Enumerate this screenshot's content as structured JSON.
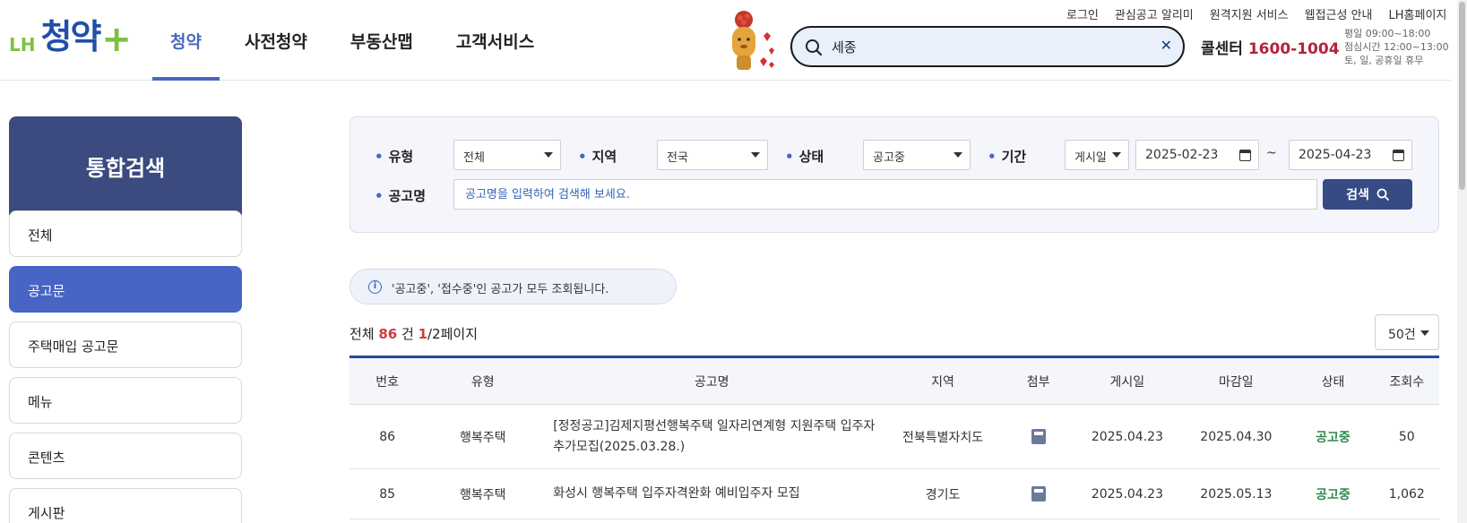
{
  "header": {
    "logo": {
      "brand": "LH",
      "name": "청약",
      "plus": "+"
    },
    "gnb": [
      "청약",
      "사전청약",
      "부동산맵",
      "고객서비스"
    ],
    "search": {
      "value": "세종"
    },
    "util_links": [
      "로그인",
      "관심공고 알리미",
      "원격지원 서비스",
      "웹접근성 안내",
      "LH홈페이지"
    ],
    "callcenter": {
      "label": "콜센터",
      "number": "1600-1004"
    },
    "hours": [
      "평일 09:00~18:00",
      "점심시간 12:00~13:00",
      "토, 일, 공휴일 휴무"
    ]
  },
  "sidebar": {
    "title": "통합검색",
    "items": [
      "전체",
      "공고문",
      "주택매입 공고문",
      "메뉴",
      "콘텐츠",
      "게시판"
    ],
    "active_index": 1
  },
  "filter": {
    "type": {
      "label": "유형",
      "value": "전체"
    },
    "region": {
      "label": "지역",
      "value": "전국"
    },
    "status": {
      "label": "상태",
      "value": "공고중"
    },
    "period": {
      "label": "기간",
      "basis": "게시일",
      "from": "2025-02-23",
      "sep": "~",
      "to": "2025-04-23"
    },
    "title": {
      "label": "공고명",
      "placeholder": "공고명을 입력하여 검색해 보세요."
    },
    "search_button": "검색"
  },
  "notice": "'공고중', '접수중'인 공고가 모두 조회됩니다.",
  "summary": {
    "prefix": "전체 ",
    "total": "86",
    "unit": " 건 ",
    "page": "1",
    "pages": "/2페이지"
  },
  "per_page": "50건",
  "table": {
    "headers": [
      "번호",
      "유형",
      "공고명",
      "지역",
      "첨부",
      "게시일",
      "마감일",
      "상태",
      "조회수"
    ],
    "rows": [
      {
        "no": "86",
        "type": "행복주택",
        "title": "[정정공고]김제지평선행복주택 일자리연계형 지원주택 입주자 추가모집(2025.03.28.)",
        "region": "전북특별자치도",
        "posted": "2025.04.23",
        "deadline": "2025.04.30",
        "status": "공고중",
        "views": "50"
      },
      {
        "no": "85",
        "type": "행복주택",
        "title": "화성시 행복주택 입주자격완화 예비입주자 모집",
        "region": "경기도",
        "posted": "2025.04.23",
        "deadline": "2025.05.13",
        "status": "공고중",
        "views": "1,062"
      }
    ]
  },
  "colors": {
    "primary": "#4a66c2",
    "navy": "#3b4a7f",
    "status_green": "#2f8a4f",
    "highlight_red": "#d13b3b"
  }
}
